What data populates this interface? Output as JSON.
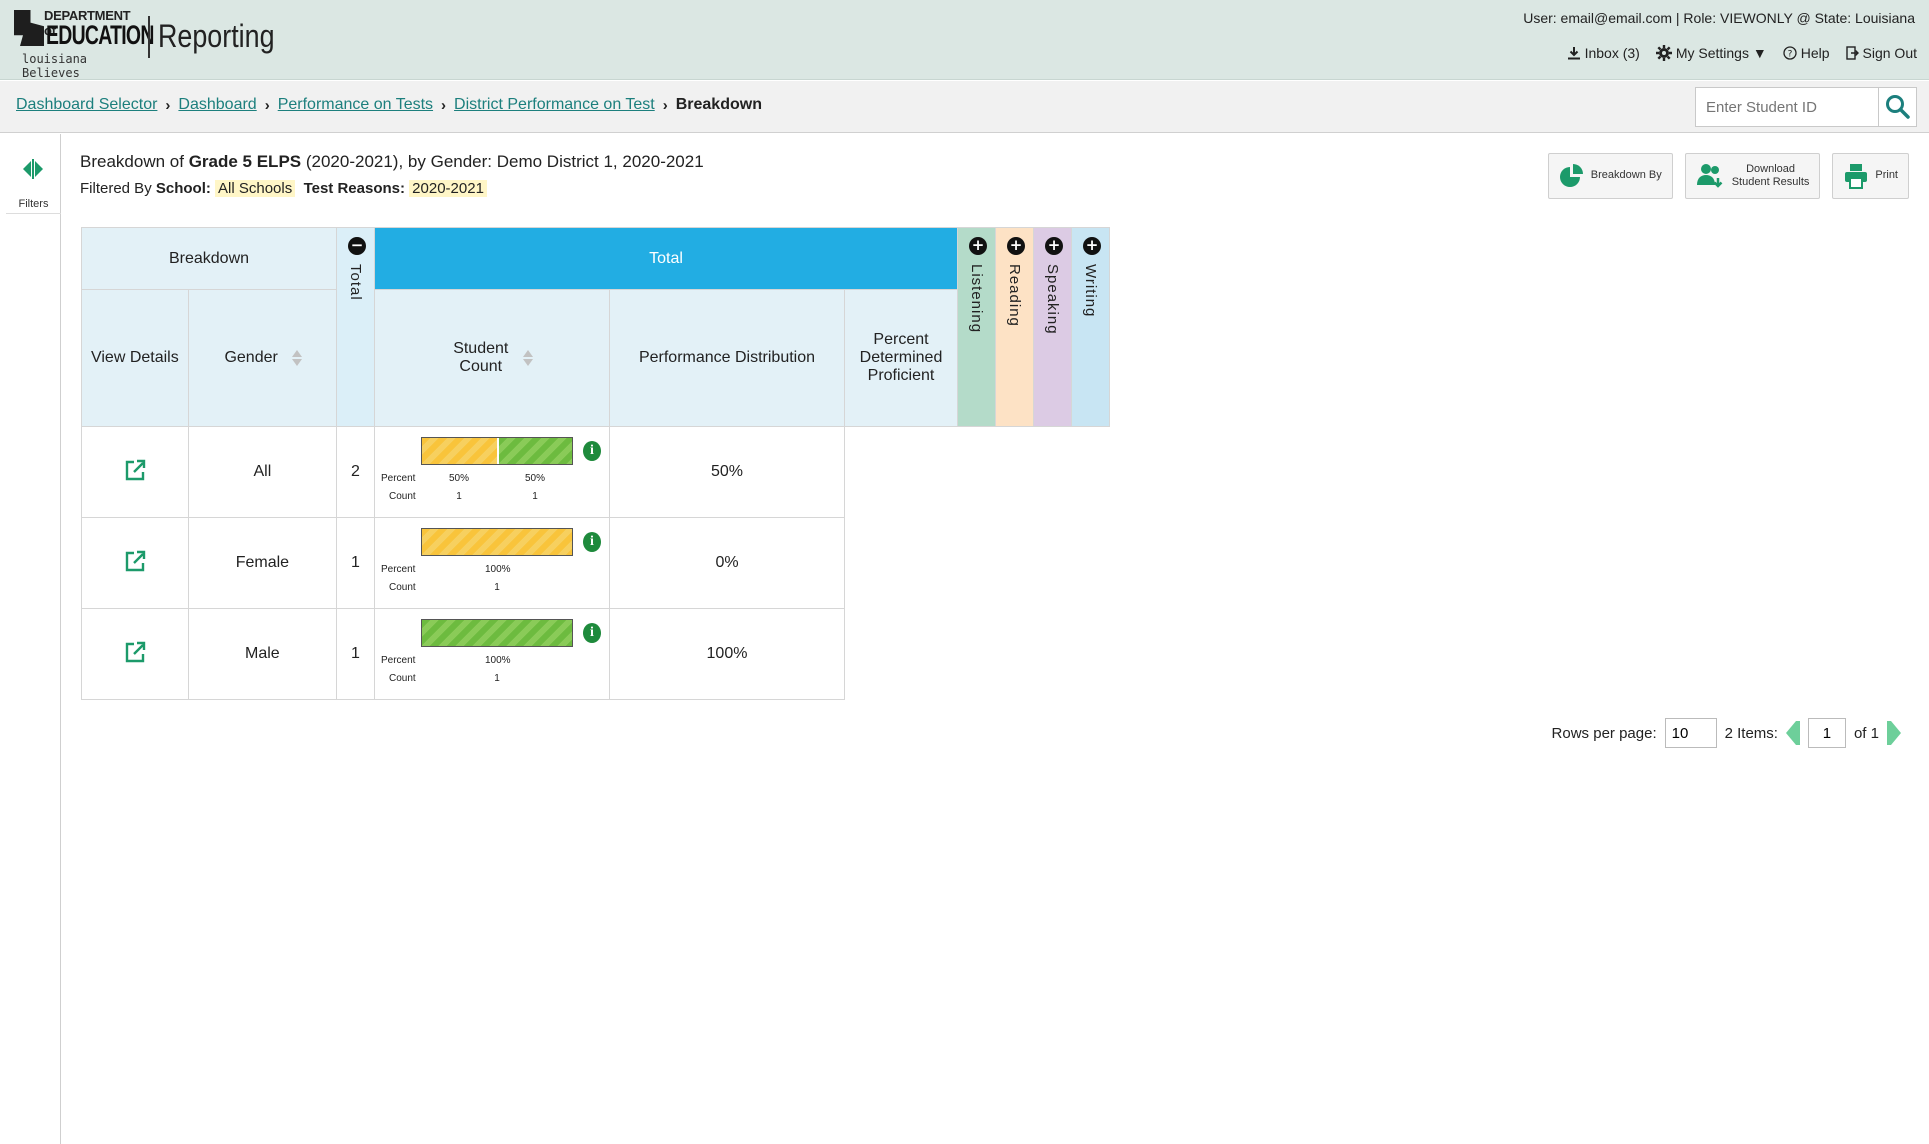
{
  "header": {
    "logo_dept": "DEPARTMENT of",
    "logo_education": "EDUCATION",
    "logo_tagline": "louisiana Believes",
    "app_title": "Reporting",
    "user_info": "User: email@email.com  |  Role: VIEWONLY @ State: Louisiana",
    "inbox_label": "Inbox (3)",
    "settings_label": "My Settings ▼",
    "help_label": "Help",
    "signout_label": "Sign Out"
  },
  "breadcrumb": {
    "items": [
      "Dashboard Selector",
      "Dashboard",
      "Performance on Tests",
      "District Performance on Test"
    ],
    "current": "Breakdown"
  },
  "search": {
    "placeholder": "Enter Student ID"
  },
  "sidebar": {
    "filters_label": "Filters"
  },
  "report": {
    "title_prefix": "Breakdown of ",
    "title_test": "Grade 5 ELPS",
    "title_suffix": " (2020-2021), by Gender: Demo District 1, 2020-2021",
    "filter_prefix": "Filtered By ",
    "school_label": "School:",
    "school_value": "All Schools",
    "reasons_label": "Test Reasons:",
    "reasons_value": "2020-2021"
  },
  "actions": {
    "breakdown_by": "Breakdown By",
    "download_line1": "Download",
    "download_line2": "Student Results",
    "print": "Print"
  },
  "table": {
    "breakdown_header": "Breakdown",
    "total_header": "Total",
    "total_col_label": "Total",
    "collapse_symbol": "−",
    "expand_symbol": "+",
    "view_details_header": "View Details",
    "gender_header": "Gender",
    "student_count_header_1": "Student",
    "student_count_header_2": "Count",
    "performance_header": "Performance Distribution",
    "proficient_header_1": "Percent",
    "proficient_header_2": "Determined",
    "proficient_header_3": "Proficient",
    "domains": [
      "Listening",
      "Reading",
      "Speaking",
      "Writing"
    ],
    "percent_label": "Percent",
    "count_label": "Count",
    "rows": [
      {
        "gender": "All",
        "student_count": "2",
        "proficient": "50%",
        "segments": [
          {
            "level": "not-proficient",
            "fraction": 0.5,
            "percent": "50%",
            "count": "1"
          },
          {
            "level": "proficient",
            "fraction": 0.5,
            "percent": "50%",
            "count": "1"
          }
        ]
      },
      {
        "gender": "Female",
        "student_count": "1",
        "proficient": "0%",
        "segments": [
          {
            "level": "not-proficient",
            "fraction": 1.0,
            "percent": "100%",
            "count": "1"
          }
        ]
      },
      {
        "gender": "Male",
        "student_count": "1",
        "proficient": "100%",
        "segments": [
          {
            "level": "proficient",
            "fraction": 1.0,
            "percent": "100%",
            "count": "1"
          }
        ]
      }
    ]
  },
  "pagination": {
    "rows_per_page_label": "Rows per page:",
    "rows_per_page_value": "10",
    "items_count": "2",
    "items_label": "Items:",
    "current_page": "1",
    "of_label": "of 1"
  },
  "colors": {
    "header_bg": "#dbe7e3",
    "total_header_blue": "#22ade3",
    "listening": "#b4dbc9",
    "reading": "#fde2c5",
    "speaking": "#dccbe4",
    "writing": "#c8e5f3",
    "not_proficient": "#f9c43b",
    "proficient": "#6dbb3f",
    "link": "#1c7f7d"
  }
}
